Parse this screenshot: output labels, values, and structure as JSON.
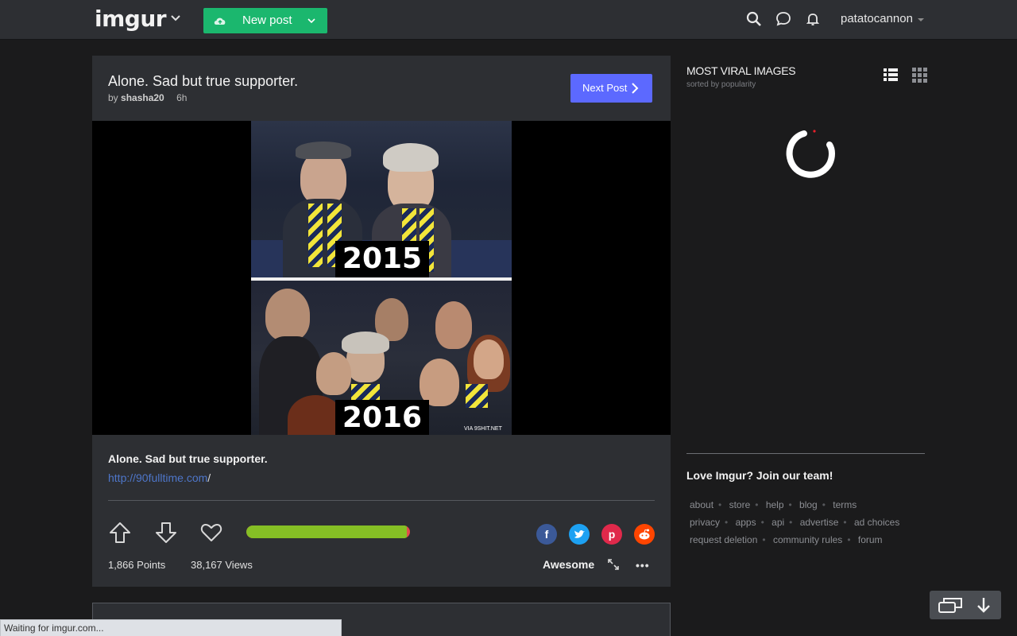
{
  "header": {
    "logo_text": "imgur",
    "new_post_label": "New post",
    "username": "patatocannon",
    "accent": "#1bb76e"
  },
  "post": {
    "title": "Alone. Sad but true supporter.",
    "by_prefix": "by",
    "author": "shasha20",
    "age": "6h",
    "next_post_label": "Next Post",
    "image": {
      "top_year": "2015",
      "bottom_year": "2016",
      "watermark": "VIA 9SHIT.NET"
    },
    "description": "Alone. Sad but true supporter.",
    "link_text": "http://90fulltime.com",
    "link_suffix": "/",
    "score_fraction": 0.98,
    "points": "1,866 Points",
    "views": "38,167 Views",
    "award": "Awesome",
    "more_label": "•••",
    "share": [
      "facebook-icon",
      "twitter-icon",
      "pinterest-icon",
      "reddit-icon"
    ]
  },
  "sidebar": {
    "title": "MOST VIRAL IMAGES",
    "subtitle": "sorted by popularity",
    "join": "Love Imgur? Join our team!",
    "footer_rows": [
      [
        "about",
        "store",
        "help",
        "blog",
        "terms"
      ],
      [
        "privacy",
        "apps",
        "api",
        "advertise",
        "ad choices"
      ],
      [
        "request deletion",
        "community rules",
        "forum"
      ]
    ]
  },
  "status_bar": "Waiting for imgur.com..."
}
